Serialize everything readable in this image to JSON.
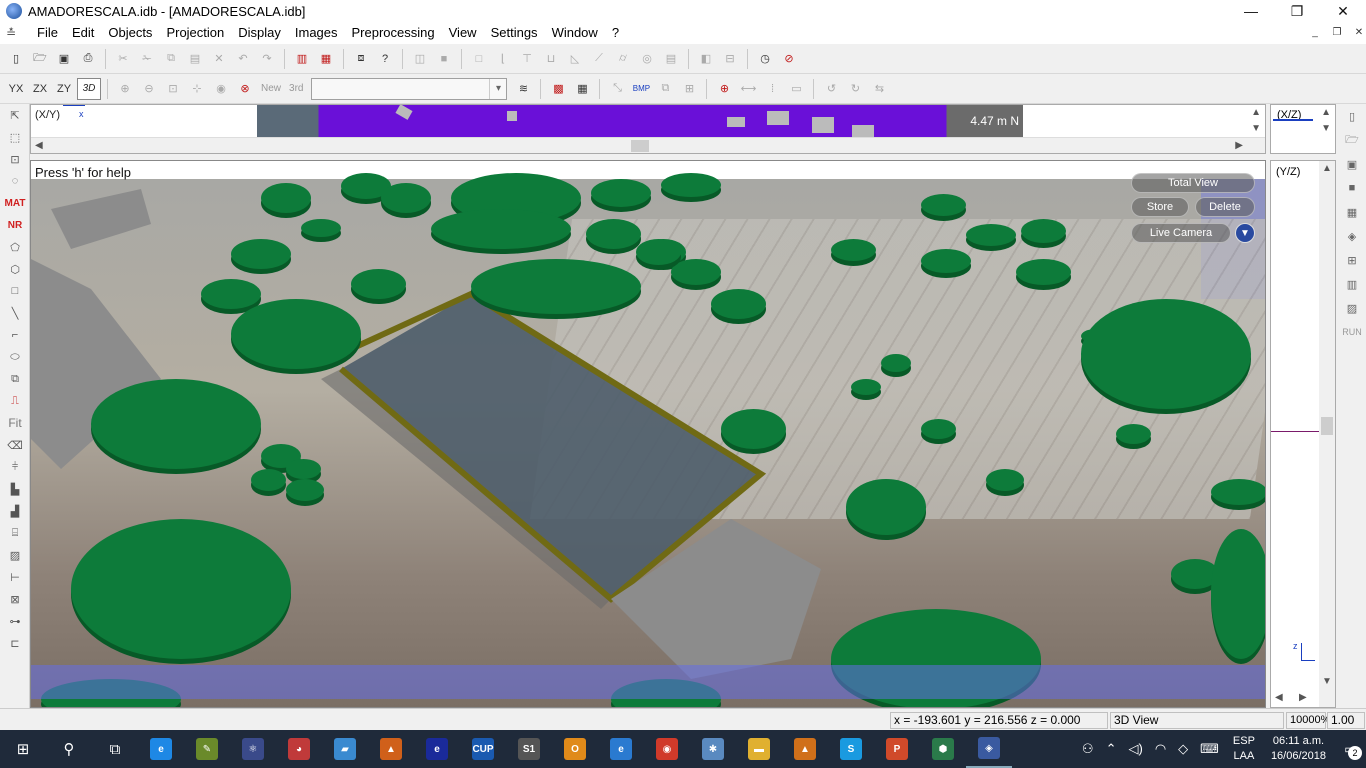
{
  "window": {
    "title": "AMADORESCALA.idb - [AMADORESCALA.idb]",
    "controls": {
      "minimize": "—",
      "maximize": "❐",
      "close": "✕"
    },
    "mdi_controls": {
      "minimize": "_",
      "restore": "❐",
      "close": "✕"
    }
  },
  "menu": [
    "File",
    "Edit",
    "Objects",
    "Projection",
    "Display",
    "Images",
    "Preprocessing",
    "View",
    "Settings",
    "Window",
    "?"
  ],
  "toolbar2": {
    "axis_buttons": [
      "YX",
      "ZX",
      "ZY",
      "3D"
    ],
    "new_label": "New",
    "third_label": "3rd",
    "combo_value": ""
  },
  "left_tools": {
    "mat": "MAT",
    "nr": "NR",
    "fit": "Fit"
  },
  "right_tools": {
    "run": "RUN"
  },
  "xy_view": {
    "label": "(X/Y)",
    "axis": "x",
    "scale": "4.47 m N"
  },
  "xz_view": {
    "label": "(X/Z)"
  },
  "yz_view": {
    "label": "(Y/Z)",
    "axis": "z"
  },
  "view3d": {
    "help_text": "Press 'h' for help",
    "camera": {
      "total_view": "Total View",
      "store": "Store",
      "delete": "Delete",
      "live_camera": "Live Camera",
      "dropdown": "▼"
    }
  },
  "status": {
    "coords": "x = -193.601 y = 216.556 z =   0.000",
    "view_name": "3D View",
    "zoom": "10000%",
    "factor": "1.00"
  },
  "taskbar": {
    "apps": [
      {
        "name": "ie-icon",
        "label": "e",
        "color": "#1e88e5"
      },
      {
        "name": "pen-app-icon",
        "label": "✎",
        "color": "#6a8a2a"
      },
      {
        "name": "atom-app-icon",
        "label": "⚛",
        "color": "#3a4a8a"
      },
      {
        "name": "paint-app-icon",
        "label": "◕",
        "color": "#c03a3a"
      },
      {
        "name": "blue-app-icon",
        "label": "▰",
        "color": "#3a8ad0"
      },
      {
        "name": "matlab-icon",
        "label": "▲",
        "color": "#d0601a"
      },
      {
        "name": "edge-dark-icon",
        "label": "e",
        "color": "#1a2a9a"
      },
      {
        "name": "cup-app-icon",
        "label": "CUP",
        "color": "#1a5ab0"
      },
      {
        "name": "s1-app-icon",
        "label": "S1",
        "color": "#555555"
      },
      {
        "name": "outlook-icon",
        "label": "O",
        "color": "#e08a1a"
      },
      {
        "name": "edge-icon",
        "label": "e",
        "color": "#2a7ad0"
      },
      {
        "name": "chrome-icon",
        "label": "◉",
        "color": "#d03a2a"
      },
      {
        "name": "gear-app-icon",
        "label": "✱",
        "color": "#5a8ac0"
      },
      {
        "name": "folder-icon",
        "label": "▬",
        "color": "#e0b030"
      },
      {
        "name": "matlab2-icon",
        "label": "▲",
        "color": "#d0701a"
      },
      {
        "name": "skype-icon",
        "label": "S",
        "color": "#1a9ae0"
      },
      {
        "name": "ppt-icon",
        "label": "P",
        "color": "#d04a2a"
      },
      {
        "name": "globe-app-icon",
        "label": "⬢",
        "color": "#2a7a4a"
      },
      {
        "name": "active-app-icon",
        "label": "◈",
        "color": "#3a5aa0"
      }
    ],
    "lang": [
      "ESP",
      "LAA"
    ],
    "time": "06:11 a.m.",
    "date": "16/06/2018",
    "notifications": "2"
  }
}
